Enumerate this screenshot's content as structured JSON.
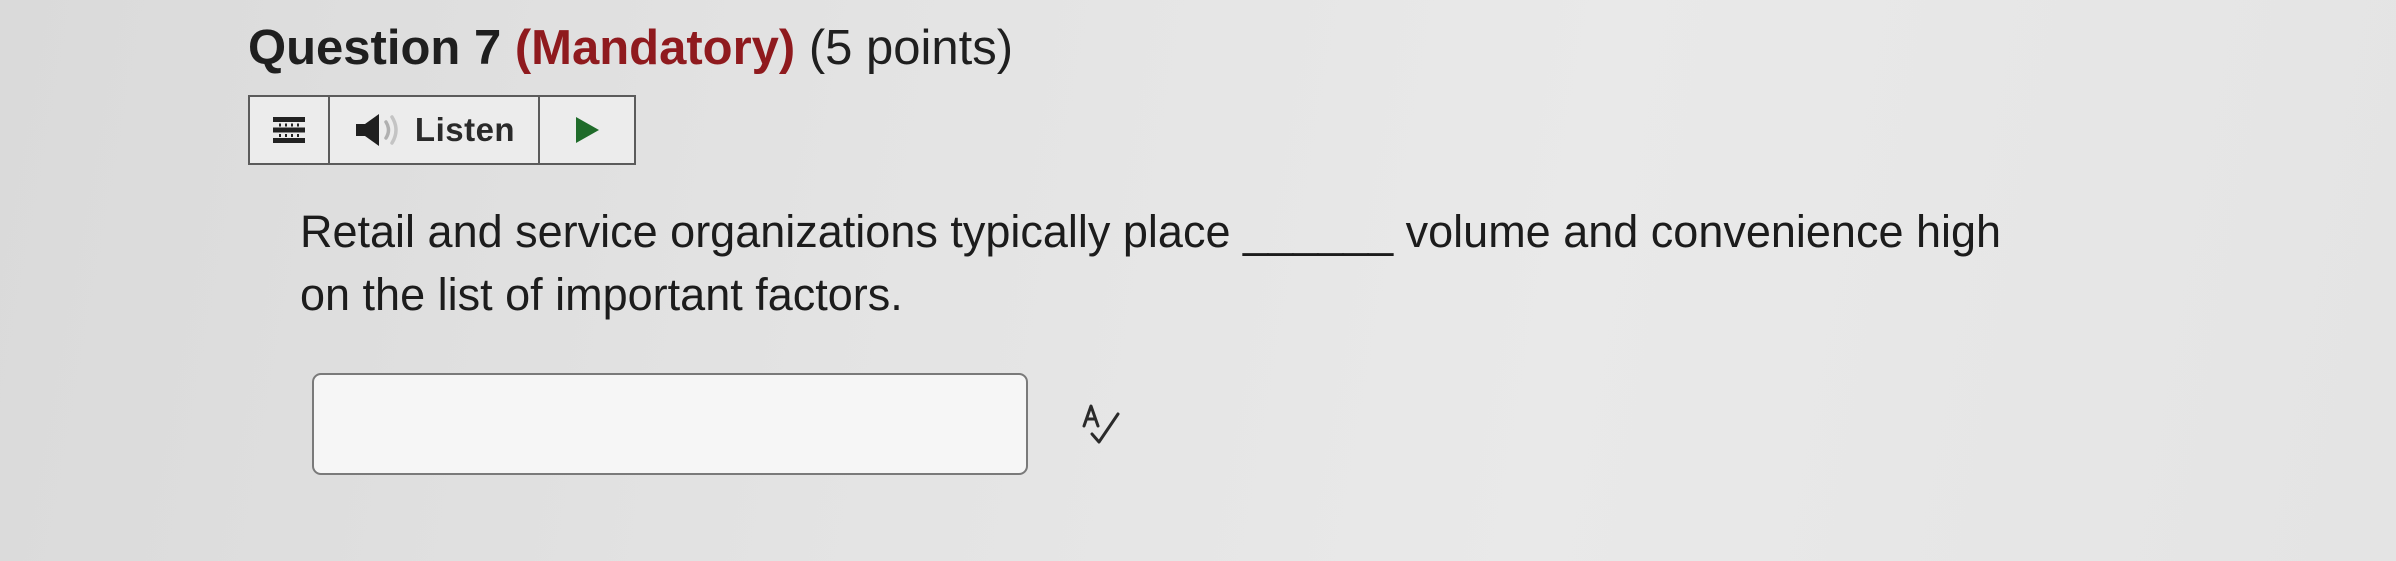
{
  "question": {
    "label": "Question 7",
    "mandatory": "(Mandatory)",
    "points": "(5 points)"
  },
  "toolbar": {
    "menu_icon": "hamburger-menu-icon",
    "speaker_icon": "speaker-icon",
    "listen_label": "Listen",
    "play_icon": "play-icon"
  },
  "body": {
    "line1": "Retail and service organizations typically place ______ volume and convenience high",
    "line2": "on the list of important factors."
  },
  "answer": {
    "value": "",
    "placeholder": ""
  },
  "spellcheck_icon": "spellcheck-icon",
  "colors": {
    "mandatory": "#8f1a1e",
    "play": "#1f6b2a",
    "text": "#1c1c1c"
  }
}
